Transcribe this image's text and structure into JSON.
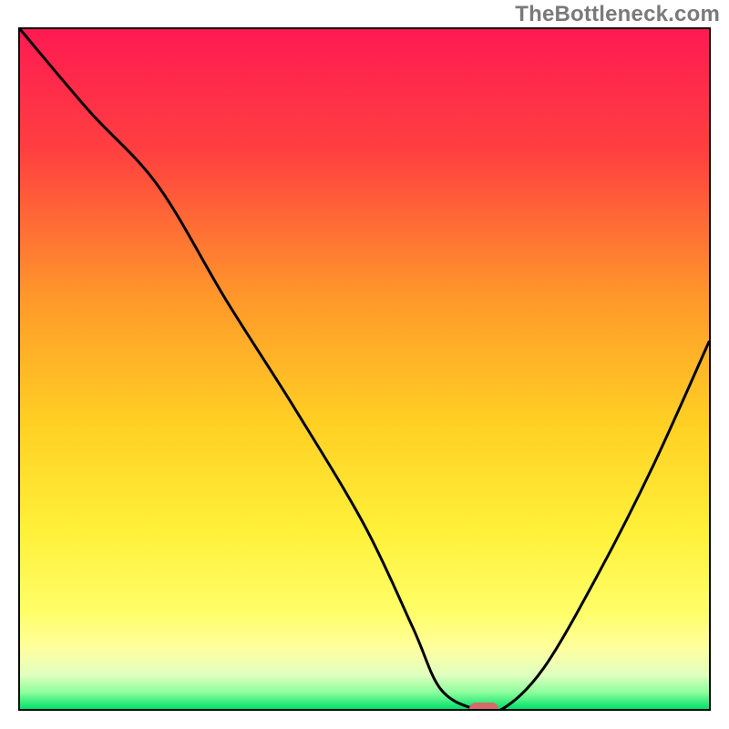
{
  "watermark": "TheBottleneck.com",
  "colors": {
    "top": "#ff1a52",
    "mid_upper": "#ff8a2a",
    "mid": "#ffd024",
    "mid_lower": "#fff13a",
    "pale_yellow": "#ffff9e",
    "pale_green": "#b9ffb0",
    "green": "#00e06a",
    "frame": "#000000",
    "marker": "#d46a6a",
    "curve": "#000000"
  },
  "chart_data": {
    "type": "line",
    "title": "",
    "xlabel": "",
    "ylabel": "",
    "xlim": [
      0,
      100
    ],
    "ylim": [
      0,
      100
    ],
    "series": [
      {
        "name": "bottleneck-curve",
        "x": [
          0,
          10,
          20,
          30,
          40,
          50,
          57,
          61,
          66,
          70,
          76,
          84,
          92,
          100
        ],
        "y": [
          100,
          88,
          77,
          60,
          44,
          27,
          12,
          3,
          0,
          0,
          6,
          20,
          36,
          54
        ]
      }
    ],
    "marker": {
      "x": 67,
      "y": 0.5
    },
    "gradient_stops": [
      {
        "offset": 0.0,
        "color": "#ff1a52"
      },
      {
        "offset": 0.18,
        "color": "#ff4040"
      },
      {
        "offset": 0.4,
        "color": "#ff9a2a"
      },
      {
        "offset": 0.58,
        "color": "#ffd024"
      },
      {
        "offset": 0.74,
        "color": "#fff13a"
      },
      {
        "offset": 0.86,
        "color": "#ffff6a"
      },
      {
        "offset": 0.91,
        "color": "#ffff9e"
      },
      {
        "offset": 0.95,
        "color": "#e0ffc0"
      },
      {
        "offset": 0.975,
        "color": "#90ff9e"
      },
      {
        "offset": 1.0,
        "color": "#00e06a"
      }
    ]
  }
}
